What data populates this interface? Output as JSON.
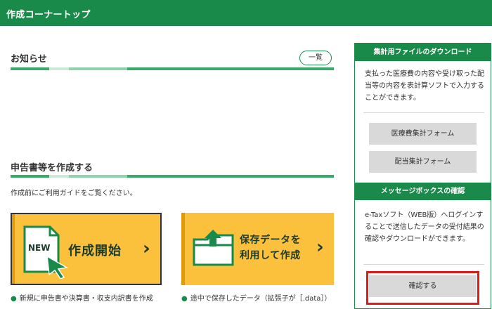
{
  "header": {
    "title": "作成コーナートップ"
  },
  "notices": {
    "title": "お知らせ",
    "list_button": "一覧"
  },
  "create": {
    "title": "申告書等を作成する",
    "guide_text": "作成前にご利用ガイドをご覧ください。",
    "start_button": {
      "label": "作成開始",
      "badge": "NEW"
    },
    "saved_button": {
      "line1": "保存データを",
      "line2": "利用して作成"
    },
    "notes": [
      "新規に申告書や決算書・収支内訳書を作成",
      "途中で保存したデータ（拡張子が［.data］）"
    ]
  },
  "download_panel": {
    "title": "集計用ファイルのダウンロード",
    "text": "支払った医療費の内容や受け取った配当等の内容を表計算ソフトで入力することができます。",
    "buttons": [
      "医療費集計フォーム",
      "配当集計フォーム"
    ]
  },
  "message_panel": {
    "title": "メッセージボックスの確認",
    "text": "e-Taxソフト（WEB版）へログインすることで送信したデータの受付結果の確認やダウンロードができます。",
    "button": "確認する"
  },
  "colors": {
    "brand_green": "#1a8a4b",
    "button_yellow": "#fbc13c",
    "highlight_red": "#e01919"
  }
}
